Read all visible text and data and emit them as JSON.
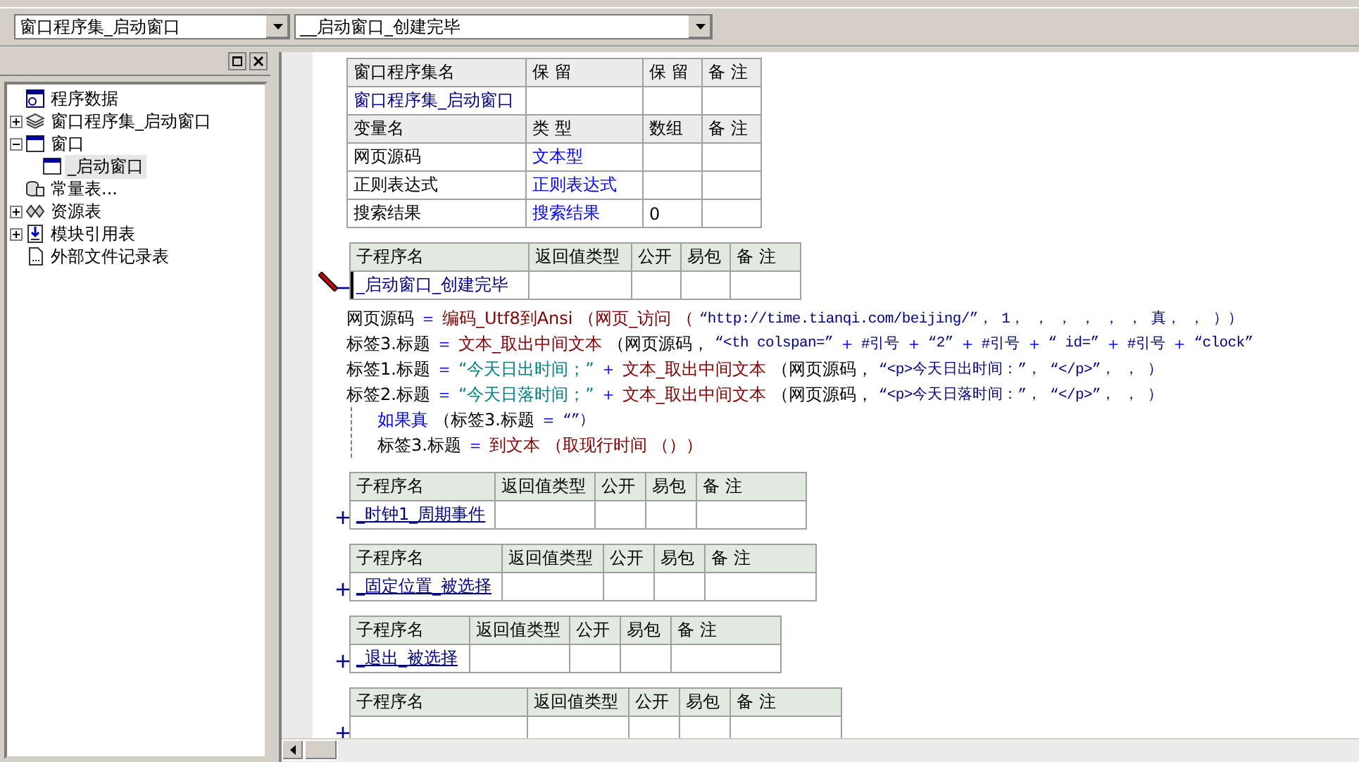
{
  "selectors": [
    {
      "value": "窗口程序集_启动窗口"
    },
    {
      "value": "__启动窗口_创建完毕"
    }
  ],
  "tree": [
    {
      "label": "程序数据",
      "kind": "project",
      "selected": false,
      "children": [
        {
          "label": "窗口程序集_启动窗口",
          "kind": "module",
          "selected": false,
          "expanded": false
        },
        {
          "label": "窗口",
          "kind": "window",
          "selected": false,
          "expanded": true,
          "children": [
            {
              "label": "_启动窗口",
              "kind": "window",
              "selected": true
            }
          ]
        },
        {
          "label": "常量表...",
          "kind": "constants",
          "selected": false
        },
        {
          "label": "资源表",
          "kind": "resources",
          "selected": false,
          "expanded": false
        },
        {
          "label": "模块引用表",
          "kind": "modules",
          "selected": false,
          "expanded": false
        },
        {
          "label": "外部文件记录表",
          "kind": "files",
          "selected": false
        }
      ]
    }
  ],
  "class_table": {
    "columns": [
      "窗口程序集名",
      "保 留",
      "保 留",
      "备 注"
    ],
    "name": "窗口程序集_启动窗口",
    "variable_columns": [
      "变量名",
      "类 型",
      "数组",
      "备 注"
    ],
    "variables": [
      {
        "name": "网页源码",
        "type": "文本型"
      },
      {
        "name": "正则表达式",
        "type": "正则表达式"
      },
      {
        "name": "搜索结果",
        "type": "搜索结果",
        "array": "0"
      }
    ]
  },
  "subroutines": [
    {
      "columns": [
        "子程序名",
        "返回值类型",
        "公开",
        "易包",
        "备 注"
      ],
      "name": "_启动窗口_创建完毕",
      "expanded": true,
      "editing": true,
      "code": [
        {
          "kind": "line",
          "tokens": [
            {
              "kind": "var",
              "text": "网页源码"
            },
            {
              "kind": "op",
              "text": "＝"
            },
            {
              "kind": "func",
              "text": "编码_Utf8到Ansi （网页_访问 （"
            },
            {
              "kind": "const",
              "text": "“http://time.tianqi.com/beijing/”， 1， ， ， ， ， ， 真， ， ））"
            }
          ]
        },
        {
          "kind": "line",
          "tokens": [
            {
              "kind": "var",
              "text": "标签3.标题"
            },
            {
              "kind": "op",
              "text": "＝"
            },
            {
              "kind": "func",
              "text": "文本_取出中间文本"
            },
            {
              "kind": "var",
              "text": "（网页源码，"
            },
            {
              "kind": "const",
              "text": "“<th colspan=”"
            },
            {
              "kind": "op",
              "text": "＋"
            },
            {
              "kind": "const",
              "text": "#引号"
            },
            {
              "kind": "op",
              "text": "＋"
            },
            {
              "kind": "const",
              "text": "“2”"
            },
            {
              "kind": "op",
              "text": "＋"
            },
            {
              "kind": "const",
              "text": "#引号"
            },
            {
              "kind": "op",
              "text": "＋"
            },
            {
              "kind": "const",
              "text": "“ id=”"
            },
            {
              "kind": "op",
              "text": "＋"
            },
            {
              "kind": "const",
              "text": "#引号"
            },
            {
              "kind": "op",
              "text": "＋"
            },
            {
              "kind": "const",
              "text": "“clock”"
            }
          ]
        },
        {
          "kind": "line",
          "tokens": [
            {
              "kind": "var",
              "text": "标签1.标题"
            },
            {
              "kind": "op",
              "text": "＝"
            },
            {
              "kind": "text",
              "text": "“今天日出时间；”"
            },
            {
              "kind": "op",
              "text": "＋"
            },
            {
              "kind": "func",
              "text": "文本_取出中间文本"
            },
            {
              "kind": "var",
              "text": "（网页源码，"
            },
            {
              "kind": "const",
              "text": "“<p>今天日出时间：”， “</p>”， ， ）"
            }
          ]
        },
        {
          "kind": "line",
          "tokens": [
            {
              "kind": "var",
              "text": "标签2.标题"
            },
            {
              "kind": "op",
              "text": "＝"
            },
            {
              "kind": "text",
              "text": "“今天日落时间；”"
            },
            {
              "kind": "op",
              "text": "＋"
            },
            {
              "kind": "func",
              "text": "文本_取出中间文本"
            },
            {
              "kind": "var",
              "text": "（网页源码，"
            },
            {
              "kind": "const",
              "text": "“<p>今天日落时间：”， “</p>”， ， ）"
            }
          ]
        },
        {
          "kind": "if",
          "tokens": [
            {
              "kind": "kw",
              "text": "如果真"
            },
            {
              "kind": "var",
              "text": "（标签3.标题"
            },
            {
              "kind": "op",
              "text": "＝"
            },
            {
              "kind": "const",
              "text": "“”）"
            }
          ],
          "children": [
            {
              "kind": "line",
              "tokens": [
                {
                  "kind": "var",
                  "text": "标签3.标题"
                },
                {
                  "kind": "op",
                  "text": "＝"
                },
                {
                  "kind": "func",
                  "text": "到文本 （取现行时间 （））"
                }
              ]
            }
          ]
        }
      ]
    },
    {
      "columns": [
        "子程序名",
        "返回值类型",
        "公开",
        "易包",
        "备 注"
      ],
      "name": "_时钟1_周期事件",
      "expanded": false,
      "editing": false
    },
    {
      "columns": [
        "子程序名",
        "返回值类型",
        "公开",
        "易包",
        "备 注"
      ],
      "name": "_固定位置_被选择",
      "expanded": false,
      "editing": false
    },
    {
      "columns": [
        "子程序名",
        "返回值类型",
        "公开",
        "易包",
        "备 注"
      ],
      "name": "_退出_被选择",
      "expanded": false,
      "editing": false
    },
    {
      "columns": [
        "子程序名",
        "返回值类型",
        "公开",
        "易包",
        "备 注"
      ],
      "expanded": false,
      "editing": false
    }
  ]
}
